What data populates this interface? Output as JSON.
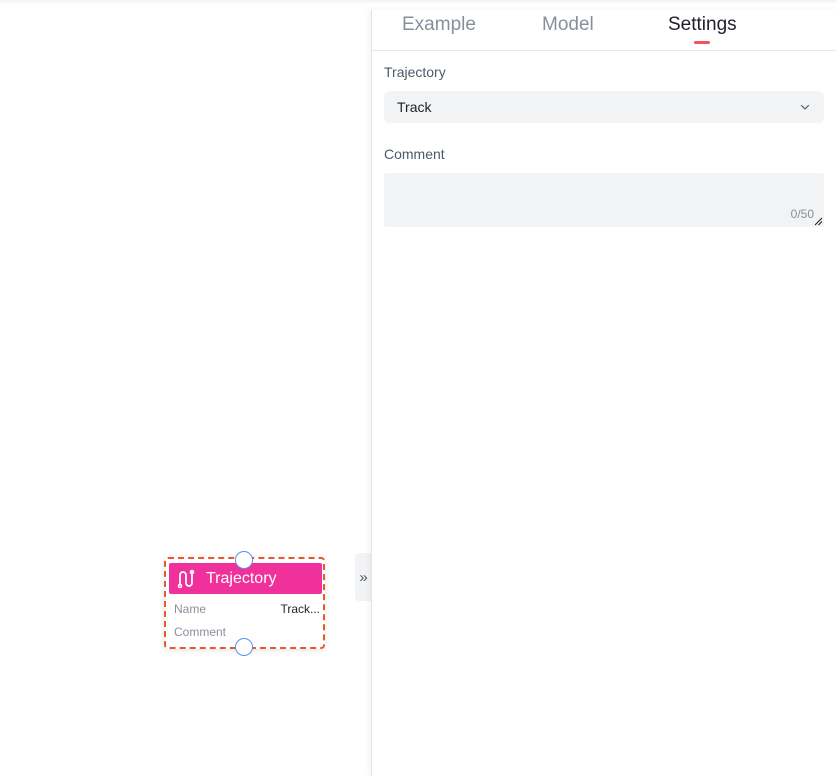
{
  "node": {
    "title": "Trajectory",
    "icon": "trajectory-path-icon",
    "header_color": "#f0309b",
    "border_color": "#e8582c",
    "rows": [
      {
        "key": "Name",
        "value": "Track..."
      },
      {
        "key": "Comment",
        "value": ""
      }
    ]
  },
  "panel": {
    "tabs": [
      {
        "label": "Example",
        "active": false
      },
      {
        "label": "Model",
        "active": false
      },
      {
        "label": "Settings",
        "active": true
      }
    ],
    "active_indicator_color": "#f5515f",
    "trajectory_label": "Trajectory",
    "trajectory_value": "Track",
    "comment_label": "Comment",
    "comment_value": "",
    "comment_counter": "0/50"
  },
  "collapse_handle": {
    "glyph": "»"
  }
}
